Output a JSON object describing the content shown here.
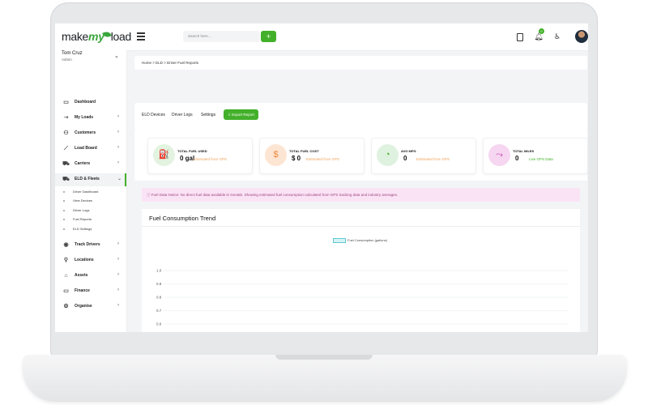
{
  "brand": {
    "make": "make",
    "my": "my",
    "load": "load"
  },
  "search": {
    "placeholder": "Search here..."
  },
  "header": {
    "add_label": "+",
    "notification_count": "0"
  },
  "user": {
    "name": "Tom Cruz",
    "role": "Admin"
  },
  "sidebar": {
    "items": [
      {
        "label": "Dashboard",
        "icon": "dashboard-icon",
        "glyph": "▭"
      },
      {
        "label": "My Loads",
        "icon": "truck-icon",
        "glyph": "➝"
      },
      {
        "label": "Customers",
        "icon": "users-icon",
        "glyph": "⚇"
      },
      {
        "label": "Load Board",
        "icon": "chart-icon",
        "glyph": "⟋"
      },
      {
        "label": "Carriers",
        "icon": "carrier-icon",
        "glyph": "⛟"
      },
      {
        "label": "ELD & Fleets",
        "icon": "fleet-icon",
        "glyph": "⛟"
      },
      {
        "label": "Track Drivers",
        "icon": "location-pin-icon",
        "glyph": "◉"
      },
      {
        "label": "Locations",
        "icon": "location-icon",
        "glyph": "⚲"
      },
      {
        "label": "Assets",
        "icon": "assets-icon",
        "glyph": "⌂"
      },
      {
        "label": "Finance",
        "icon": "finance-icon",
        "glyph": "▭"
      },
      {
        "label": "Organise",
        "icon": "organise-icon",
        "glyph": "⚙"
      }
    ],
    "sub_items": [
      "Driver Dashboard",
      "View Devices",
      "Driver Logs",
      "Fuel Reports",
      "ELD Settings"
    ]
  },
  "breadcrumb": "Home > ELD > Driver Fuel Reports",
  "tabs": [
    "ELD Devices",
    "Driver Logs",
    "Settings"
  ],
  "export_label": "⇩ Export Report",
  "stats": [
    {
      "label": "TOTAL FUEL USED",
      "value": "0 gal",
      "note": "Estimated from GPS",
      "icon": "fuel-pump-icon",
      "glyph": "⛽",
      "bg": "#e2f3df",
      "fg": "#43b02a",
      "note_color": "#f0a35a"
    },
    {
      "label": "TOTAL FUEL COST",
      "value": "$ 0",
      "note": "Estimated from GPS",
      "icon": "dollar-icon",
      "glyph": "$",
      "bg": "#fde5d3",
      "fg": "#f08a3a",
      "note_color": "#f0a35a"
    },
    {
      "label": "AVG MPG",
      "value": "0",
      "note": "Estimated from GPS",
      "icon": "gauge-icon",
      "glyph": "◔",
      "bg": "#dff2e0",
      "fg": "#43b02a",
      "note_color": "#f0a35a"
    },
    {
      "label": "TOTAL MILES",
      "value": "0",
      "note": "Live GPS Data",
      "icon": "road-icon",
      "glyph": "⤳",
      "bg": "#f6d6f1",
      "fg": "#c23aa6",
      "note_color": "#43b02a"
    }
  ],
  "notice": "ⓘ Fuel Data Notice: No direct fuel data available in Geotab. Showing estimated fuel consumption calculated from GPS tracking data and industry averages.",
  "chart_data": {
    "type": "line",
    "title": "Fuel Consumption Trend",
    "series": [
      {
        "name": "Fuel Consumption (gallons)",
        "values": []
      }
    ],
    "ytick_labels": [
      "1.0",
      "0.9",
      "0.8",
      "0.7",
      "0.6",
      "0.5",
      "0.4",
      "0.3",
      "0.2"
    ],
    "ylim": [
      0,
      1.0
    ],
    "grid": true,
    "legend": "top-center",
    "legend_color": "#5ec8d2"
  }
}
